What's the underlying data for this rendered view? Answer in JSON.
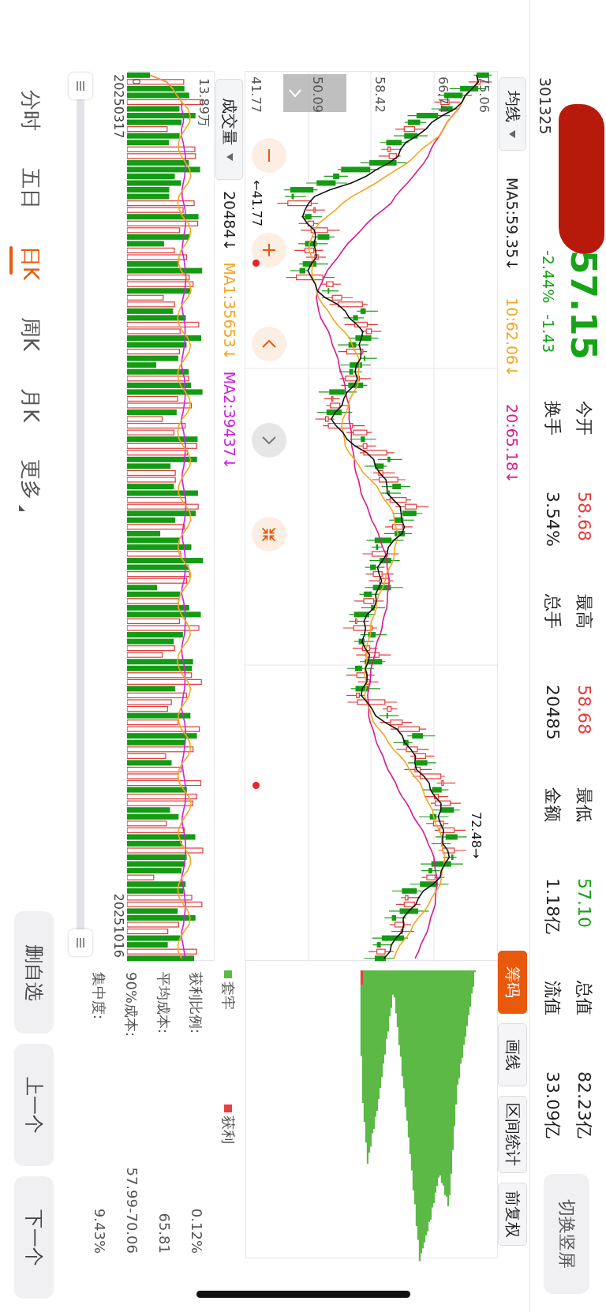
{
  "header": {
    "code": "301325",
    "price": "57.15",
    "change_pct": "-2.44%",
    "change": "-1.43",
    "color": "#17a317",
    "switch_button": "切换竖屏"
  },
  "stats": [
    {
      "label": "今开",
      "value": "58.68",
      "color": "#e8383a"
    },
    {
      "label": "最高",
      "value": "58.68",
      "color": "#e8383a"
    },
    {
      "label": "最低",
      "value": "57.10",
      "color": "#17a317"
    },
    {
      "label": "总值",
      "value": "82.23亿",
      "color": "#222222"
    },
    {
      "label": "换手",
      "value": "3.54%",
      "color": "#222222"
    },
    {
      "label": "总手",
      "value": "20485",
      "color": "#222222"
    },
    {
      "label": "金额",
      "value": "1.18亿",
      "color": "#222222"
    },
    {
      "label": "流值",
      "value": "33.09亿",
      "color": "#222222"
    }
  ],
  "ma_toolbar": {
    "selector": "均线",
    "items": [
      {
        "text": "MA5:59.35↓",
        "color": "#222222"
      },
      {
        "text": "10:62.06↓",
        "color": "#f5a623"
      },
      {
        "text": "20:65.18↓",
        "color": "#d81b8c"
      }
    ]
  },
  "chart_tools": [
    {
      "label": "筹码",
      "selected": true
    },
    {
      "label": "画线",
      "selected": false
    },
    {
      "label": "区间统计",
      "selected": false
    },
    {
      "label": "前复权",
      "selected": false
    }
  ],
  "price_labels": [
    "75.06",
    "66.74",
    "58.42",
    "50.09",
    "41.77"
  ],
  "markers": [
    {
      "text": "←41.77"
    },
    {
      "text": "72.48→"
    }
  ],
  "zoom_controls": [
    {
      "kind": "minus",
      "disabled": false
    },
    {
      "kind": "plus",
      "disabled": false
    },
    {
      "kind": "left",
      "disabled": false
    },
    {
      "kind": "right",
      "disabled": true
    },
    {
      "kind": "shrink",
      "disabled": false
    }
  ],
  "volume_toolbar": {
    "selector": "成交量",
    "items": [
      {
        "text": "20484↓",
        "color": "#222222"
      },
      {
        "text": "MA1:35653↓",
        "color": "#f5a623"
      },
      {
        "text": "MA2:39437↓",
        "color": "#cc22dd"
      }
    ]
  },
  "volume_labels": {
    "max": "13.89万",
    "min": "0"
  },
  "dates": [
    "20250317",
    "20251016"
  ],
  "range_slider": {
    "level": 1
  },
  "chip_panel": {
    "legend": [
      {
        "label": "套牢",
        "color": "#5cb946"
      },
      {
        "label": "获利",
        "color": "#e84040"
      }
    ],
    "rows": [
      {
        "label": "获利比例:",
        "value": "0.12%"
      },
      {
        "label": "平均成本:",
        "value": "65.81"
      },
      {
        "label": "90%成本:",
        "value": "57.99-70.06"
      },
      {
        "label": "集中度:",
        "value": "9.43%"
      }
    ]
  },
  "period_tabs": [
    {
      "label": "分时",
      "selected": false,
      "menu": false
    },
    {
      "label": "五日",
      "selected": false,
      "menu": false
    },
    {
      "label": "日K",
      "selected": true,
      "menu": false
    },
    {
      "label": "周K",
      "selected": false,
      "menu": false
    },
    {
      "label": "月K",
      "selected": false,
      "menu": false
    },
    {
      "label": "更多",
      "selected": false,
      "menu": true
    }
  ],
  "actions": [
    "删自选",
    "上一个",
    "下一个"
  ]
}
